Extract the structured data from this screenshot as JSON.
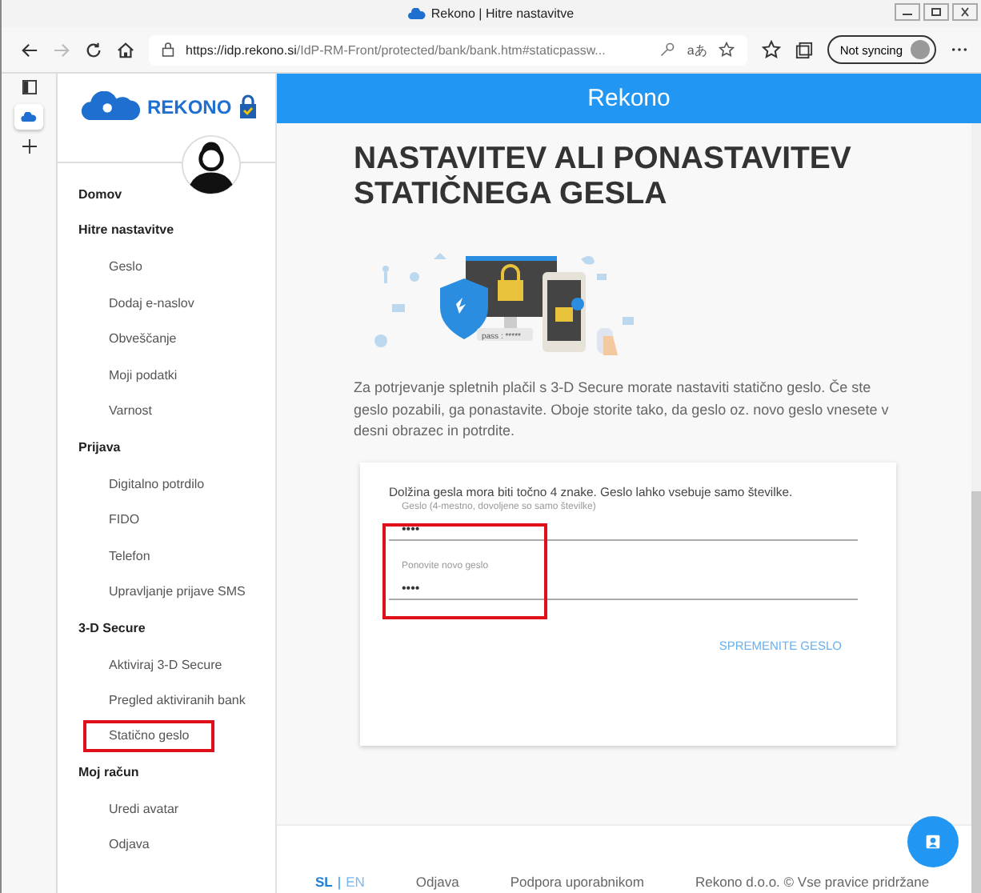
{
  "window": {
    "title": "Rekono | Hitre nastavitve"
  },
  "browser": {
    "url_host": "https://idp.rekono.si",
    "url_path": "/IdP-RM-Front/protected/bank/bank.htm#staticpassw...",
    "reader_label": "aあ",
    "sync_label": "Not syncing"
  },
  "brand": {
    "name": "REKONO"
  },
  "header": {
    "title": "Rekono"
  },
  "sidebar": {
    "sections": [
      {
        "label": "Domov"
      },
      {
        "label": "Hitre nastavitve",
        "items": [
          {
            "label": "Geslo",
            "highlighted": false
          },
          {
            "label": "Dodaj e-naslov",
            "highlighted": false
          },
          {
            "label": "Obveščanje",
            "highlighted": false
          },
          {
            "label": "Moji podatki",
            "highlighted": false
          },
          {
            "label": "Varnost",
            "highlighted": false
          }
        ]
      },
      {
        "label": "Prijava",
        "items": [
          {
            "label": "Digitalno potrdilo",
            "highlighted": false
          },
          {
            "label": "FIDO",
            "highlighted": false
          },
          {
            "label": "Telefon",
            "highlighted": false
          },
          {
            "label": "Upravljanje prijave SMS",
            "highlighted": false
          }
        ]
      },
      {
        "label": "3-D Secure",
        "items": [
          {
            "label": "Aktiviraj 3-D Secure",
            "highlighted": false
          },
          {
            "label": "Pregled aktiviranih bank",
            "highlighted": false
          },
          {
            "label": "Statično geslo",
            "highlighted": true
          }
        ]
      },
      {
        "label": "Moj račun",
        "items": [
          {
            "label": "Uredi avatar",
            "highlighted": false
          },
          {
            "label": "Odjava",
            "highlighted": false
          }
        ]
      }
    ]
  },
  "page": {
    "heading": "NASTAVITEV ALI PONASTAVITEV STATIČNEGA GESLA",
    "illustration_caption": "pass : *****",
    "description": "Za potrjevanje spletnih plačil s 3-D Secure morate nastaviti statično geslo. Če ste geslo pozabili, ga ponastavite. Oboje storite tako, da geslo oz. novo geslo vnesete v desni obrazec in potrdite."
  },
  "form": {
    "note": "Dolžina gesla mora biti točno 4 znake. Geslo lahko vsebuje samo številke.",
    "fields_highlighted": true,
    "fields": [
      {
        "label": "Geslo (4-mestno, dovoljene so samo številke)",
        "value": "••••"
      },
      {
        "label": "Ponovite novo geslo",
        "value": "••••"
      }
    ],
    "submit": "SPREMENITE GESLO"
  },
  "footer": {
    "languages": [
      {
        "label": "SL",
        "selected": true
      },
      {
        "label": "EN",
        "selected": false
      }
    ],
    "language_separator": "|",
    "links": [
      "Odjava",
      "Podpora uporabnikom",
      "Rekono d.o.o. © Vse pravice pridržane"
    ]
  }
}
